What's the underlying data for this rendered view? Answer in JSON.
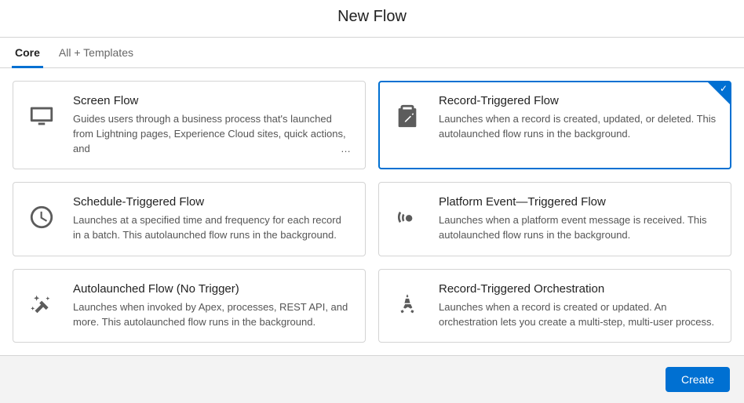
{
  "header": {
    "title": "New Flow"
  },
  "tabs": {
    "core": "Core",
    "all_templates": "All + Templates"
  },
  "cards": {
    "screen_flow": {
      "title": "Screen Flow",
      "desc": "Guides users through a business process that's launched from Lightning pages, Experience Cloud sites, quick actions, and"
    },
    "record_triggered": {
      "title": "Record-Triggered Flow",
      "desc": "Launches when a record is created, updated, or deleted. This autolaunched flow runs in the background."
    },
    "schedule_triggered": {
      "title": "Schedule-Triggered Flow",
      "desc": "Launches at a specified time and frequency for each record in a batch. This autolaunched flow runs in the background."
    },
    "platform_event": {
      "title": "Platform Event—Triggered Flow",
      "desc": "Launches when a platform event message is received. This autolaunched flow runs in the background."
    },
    "autolaunched": {
      "title": "Autolaunched Flow (No Trigger)",
      "desc": "Launches when invoked by Apex, processes, REST API, and more. This autolaunched flow runs in the background."
    },
    "orchestration": {
      "title": "Record-Triggered Orchestration",
      "desc": "Launches when a record is created or updated. An orchestration lets you create a multi-step, multi-user process."
    }
  },
  "footer": {
    "create": "Create"
  },
  "misc": {
    "ellipsis": "…",
    "check": "✓"
  }
}
